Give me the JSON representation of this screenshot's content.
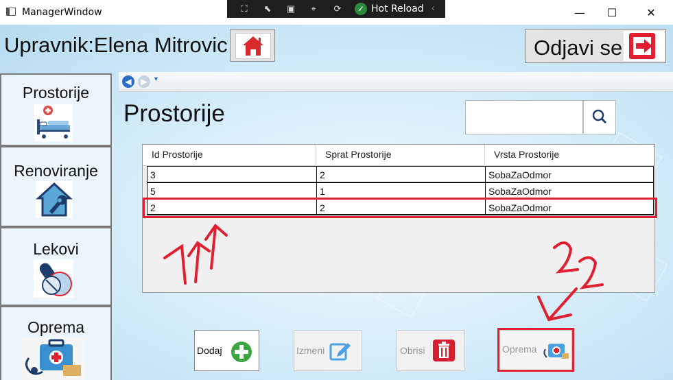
{
  "window": {
    "title": "ManagerWindow",
    "hot_reload_label": "Hot Reload",
    "minimize_glyph": "—",
    "maximize_glyph": "☐",
    "close_glyph": "✕"
  },
  "header": {
    "user_label": "Upravnik:Elena Mitrovic",
    "logout_label": "Odjavi se"
  },
  "sidebar": {
    "items": [
      {
        "label": "Prostorije",
        "icon": "hospital-bed-icon"
      },
      {
        "label": "Renoviranje",
        "icon": "house-wrench-icon"
      },
      {
        "label": "Lekovi",
        "icon": "pills-icon"
      },
      {
        "label": "Oprema",
        "icon": "medical-kit-icon"
      }
    ]
  },
  "page": {
    "title": "Prostorije",
    "search_value": ""
  },
  "table": {
    "columns": [
      "Id Prostorije",
      "Sprat Prostorije",
      "Vrsta Prostorije"
    ],
    "rows": [
      [
        "3",
        "2",
        "SobaZaOdmor"
      ],
      [
        "5",
        "1",
        "SobaZaOdmor"
      ],
      [
        "2",
        "2",
        "SobaZaOdmor"
      ]
    ],
    "selected_row_index": 2
  },
  "actions": {
    "add_label": "Dodaj",
    "edit_label": "Izmeni",
    "delete_label": "Obrisi",
    "equipment_label": "Oprema"
  },
  "colors": {
    "accent_red": "#e02030",
    "icon_blue": "#1e88c8",
    "add_green": "#3aa640"
  }
}
